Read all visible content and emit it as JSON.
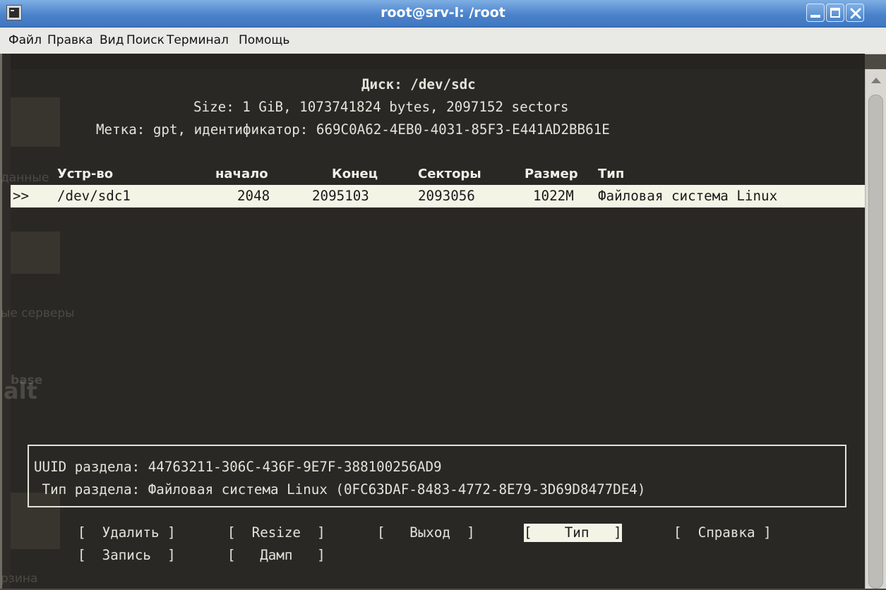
{
  "window": {
    "title": "root@srv-l: /root",
    "title_color": "#4b83cb"
  },
  "menu": [
    "Файл",
    "Правка",
    "Вид",
    "Поиск",
    "Терминал",
    "Помощь"
  ],
  "disk": {
    "title": "Диск: /dev/sdc",
    "size_line": "Size: 1 GiB, 1073741824 bytes, 2097152 sectors",
    "label_line": "Метка: gpt, идентификатор: 669C0A62-4EB0-4031-85F3-E441AD2BB61E"
  },
  "table": {
    "headers": [
      "Устр-во",
      "начало",
      "Конец",
      "Секторы",
      "Размер",
      "Тип"
    ],
    "rows": [
      {
        "marker": ">>",
        "device": "/dev/sdc1",
        "start": "2048",
        "end": "2095103",
        "sectors": "2093056",
        "size": "1022M",
        "type": "Файловая система Linux"
      }
    ]
  },
  "partition_info": {
    "uuid_line": "UUID раздела: 44763211-306C-436F-9E7F-388100256AD9",
    "type_line": " Тип раздела: Файловая система Linux (0FC63DAF-8483-4772-8E79-3D69D8477DE4)"
  },
  "buttons": {
    "row1": [
      "[  Удалить ]",
      "[  Resize  ]",
      "[   Выход  ]",
      "[    Тип   ]",
      "[  Справка ]"
    ],
    "row2": [
      "[  Запись  ]",
      "[   Дамп   ]"
    ],
    "selected": "Тип"
  },
  "background_desktop": {
    "labels": [
      "данные",
      "ые серверы",
      "base",
      "alt",
      "рзина"
    ]
  }
}
